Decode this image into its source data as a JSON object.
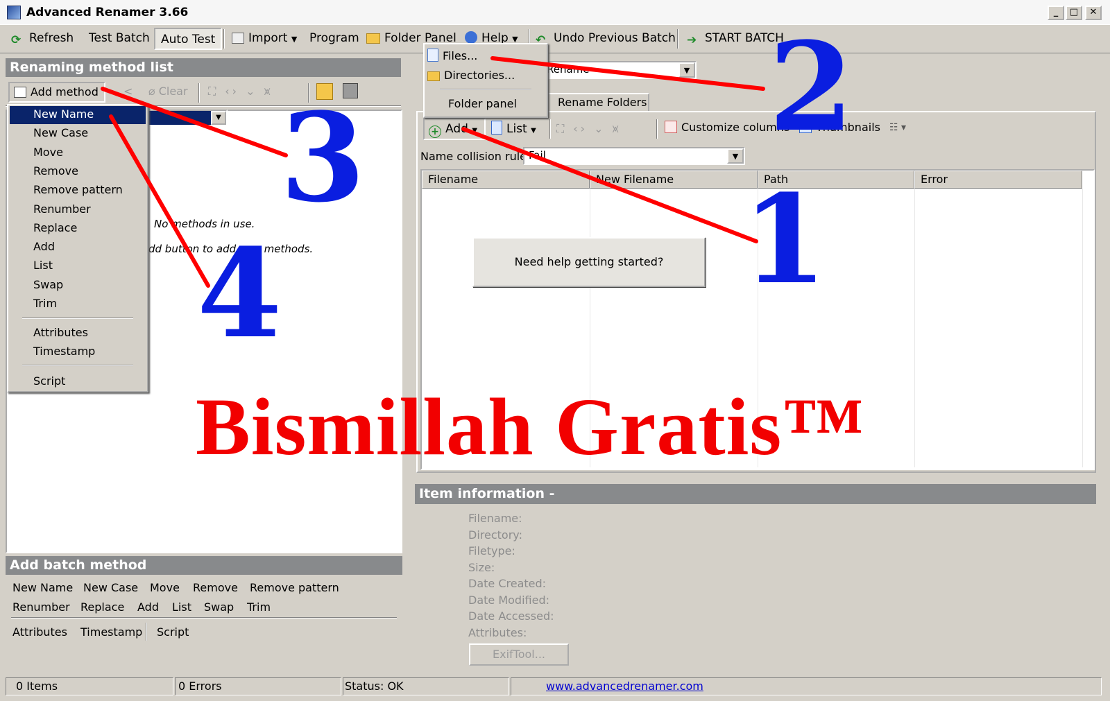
{
  "window": {
    "title": "Advanced Renamer 3.66",
    "minimize": "_",
    "maximize": "□",
    "close": "✕"
  },
  "toolbar": {
    "refresh": "Refresh",
    "test_batch": "Test Batch",
    "auto_test": "Auto Test",
    "import": "Import",
    "program": "Program",
    "folder_panel": "Folder Panel",
    "help": "Help",
    "undo": "Undo Previous Batch",
    "start": "START BATCH"
  },
  "import_menu": {
    "files": "Files...",
    "directories": "Directories...",
    "folder_panel": "Folder panel"
  },
  "left": {
    "header": "Renaming method list",
    "add_method": "Add method",
    "clear": "Clear",
    "empty_line1": "No methods in use.",
    "empty_line2": "dd button to add new methods."
  },
  "method_menu": {
    "items": [
      "New Name",
      "New Case",
      "Move",
      "Remove",
      "Remove pattern",
      "Renumber",
      "Replace",
      "Add",
      "List",
      "Swap",
      "Trim"
    ],
    "items2": [
      "Attributes",
      "Timestamp"
    ],
    "items3": [
      "Script"
    ]
  },
  "batch": {
    "header": "Add batch method",
    "row1": [
      "New Name",
      "New Case",
      "Move",
      "Remove",
      "Remove pattern"
    ],
    "row2": [
      "Renumber",
      "Replace",
      "Add",
      "List",
      "Swap",
      "Trim"
    ],
    "row3": [
      "Attributes",
      "Timestamp",
      "Script"
    ]
  },
  "right": {
    "mode_value": "Rename",
    "tab_folders": "Rename Folders",
    "add": "Add",
    "list": "List",
    "customize": "Customize columns",
    "thumbnails": "Thumbnails",
    "collision_label": "Name collision rule:",
    "collision_value": "Fail",
    "columns": [
      "Filename",
      "New Filename",
      "Path",
      "Error"
    ],
    "help_button": "Need help getting started?"
  },
  "item_info": {
    "header": "Item information -",
    "labels": [
      "Filename:",
      "Directory:",
      "Filetype:",
      "Size:",
      "Date Created:",
      "Date Modified:",
      "Date Accessed:",
      "Attributes:"
    ],
    "exiftool": "ExifTool..."
  },
  "status": {
    "items": "0 Items",
    "errors": "0 Errors",
    "status": "Status: OK",
    "link": "www.advancedrenamer.com"
  },
  "overlay": {
    "n1": "1",
    "n2": "2",
    "n3": "3",
    "n4": "4",
    "watermark": "Bismillah Gratis™"
  },
  "colors": {
    "annotation_line": "#ff0000",
    "annotation_number": "#0a1ee0",
    "watermark": "#f20000",
    "selection": "#0a246a"
  }
}
